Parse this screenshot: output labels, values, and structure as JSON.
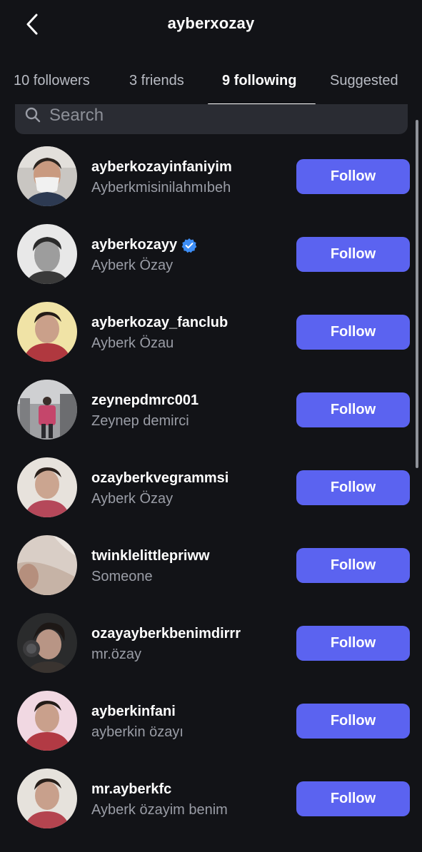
{
  "header": {
    "title": "ayberxozay",
    "back_icon": "chevron-left-icon"
  },
  "tabs": [
    {
      "label": "10 followers",
      "active": false
    },
    {
      "label": "3 friends",
      "active": false
    },
    {
      "label": "9 following",
      "active": true
    },
    {
      "label": "Suggested",
      "active": false
    }
  ],
  "search": {
    "placeholder": "Search",
    "icon": "search-icon"
  },
  "colors": {
    "background": "#121317",
    "follow_button": "#5b63f0",
    "verified_badge": "#3d8ef7",
    "secondary_text": "#9a9da6"
  },
  "follow_label": "Follow",
  "accounts": [
    {
      "username": "ayberkozayinfaniyim",
      "name": "Ayberkmisinilahmıbeh",
      "verified": false
    },
    {
      "username": "ayberkozayy",
      "name": "Ayberk Özay",
      "verified": true
    },
    {
      "username": "ayberkozay_fanclub",
      "name": "Ayberk Özau",
      "verified": false
    },
    {
      "username": "zeynepdmrc001",
      "name": "Zeynep demirci",
      "verified": false
    },
    {
      "username": "ozayberkvegrammsi",
      "name": "Ayberk Özay",
      "verified": false
    },
    {
      "username": "twinklelittlepriww",
      "name": "Someone",
      "verified": false
    },
    {
      "username": "ozayayberkbenimdirrr",
      "name": "mr.özay",
      "verified": false
    },
    {
      "username": "ayberkinfani",
      "name": "ayberkin özayı",
      "verified": false
    },
    {
      "username": "mr.ayberkfc",
      "name": "Ayberk özayim benim",
      "verified": false
    }
  ]
}
